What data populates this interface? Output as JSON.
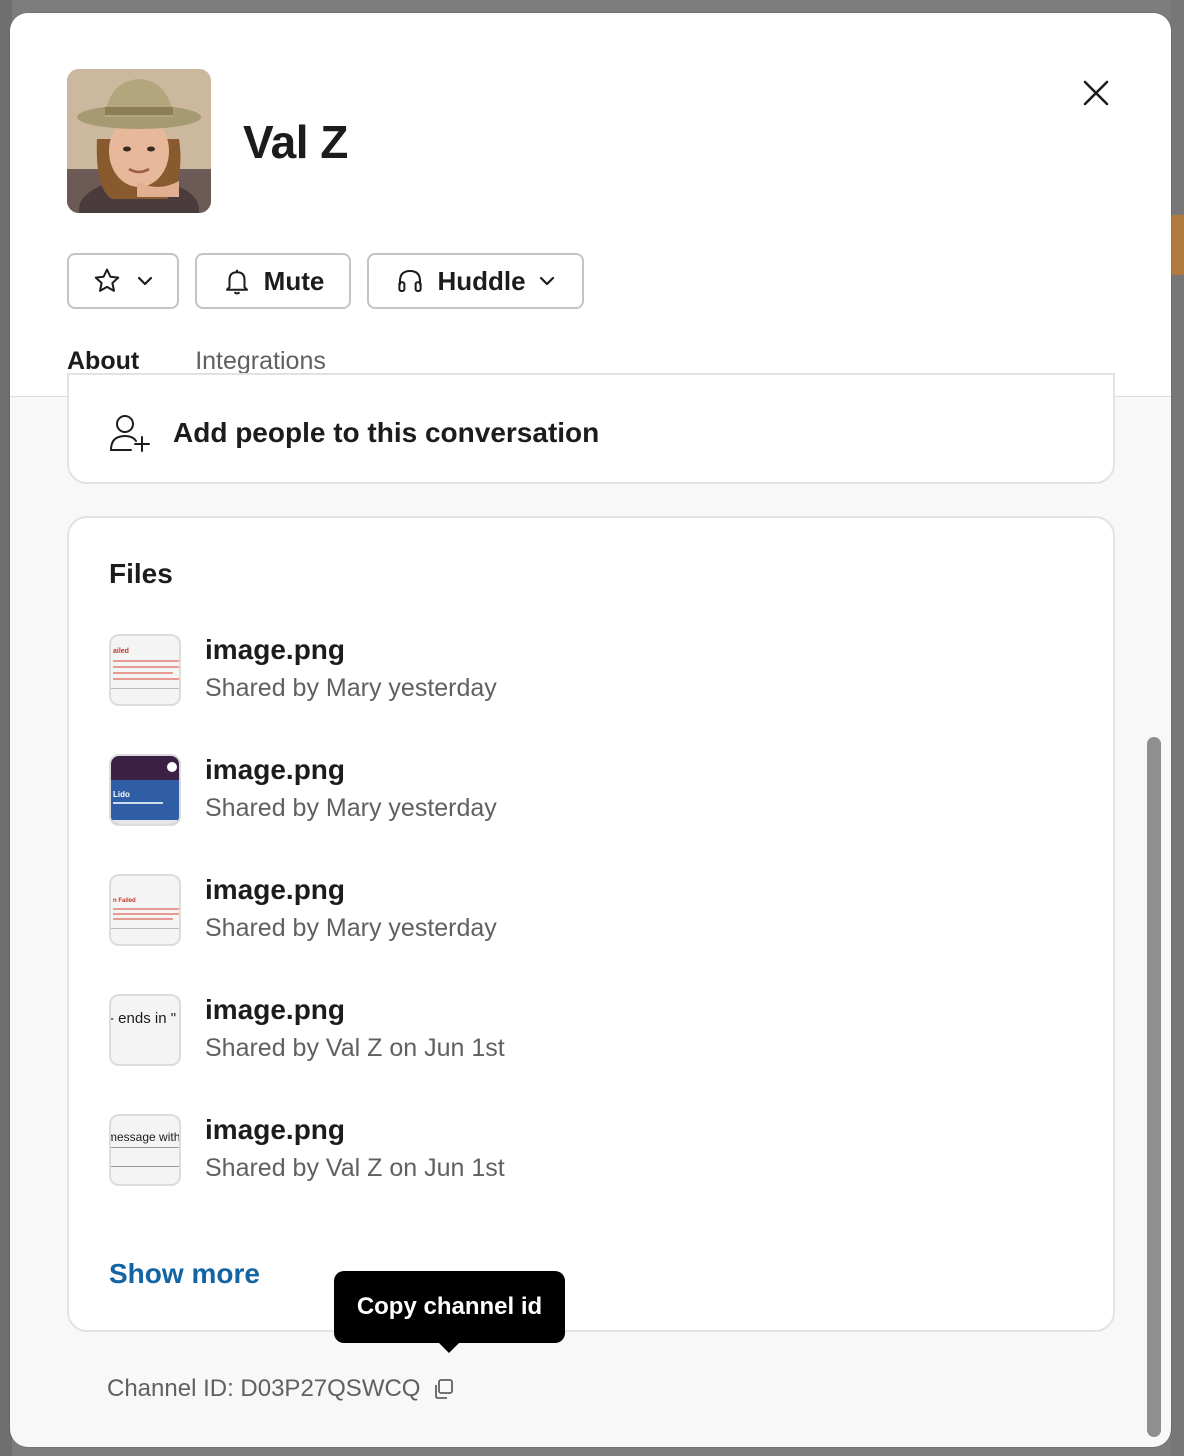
{
  "profile": {
    "name": "Val Z"
  },
  "actions": {
    "star_icon": "star-icon",
    "mute_label": "Mute",
    "huddle_label": "Huddle"
  },
  "tabs": [
    {
      "label": "About",
      "active": true
    },
    {
      "label": "Integrations",
      "active": false
    }
  ],
  "add_people": {
    "label": "Add people to this conversation"
  },
  "files": {
    "title": "Files",
    "items": [
      {
        "name": "image.png",
        "meta": "Shared by Mary yesterday",
        "thumb_text": "ailed"
      },
      {
        "name": "image.png",
        "meta": "Shared by Mary yesterday",
        "thumb_text": "Lido"
      },
      {
        "name": "image.png",
        "meta": "Shared by Mary yesterday",
        "thumb_text": "n Failed"
      },
      {
        "name": "image.png",
        "meta": "Shared by Val Z on Jun 1st",
        "thumb_text": "- ends in \""
      },
      {
        "name": "image.png",
        "meta": "Shared by Val Z on Jun 1st",
        "thumb_text": "message with"
      }
    ],
    "show_more": "Show more"
  },
  "footer": {
    "channel_id_text": "Channel ID: D03P27QSWCQ"
  },
  "tooltip": {
    "text": "Copy channel id"
  },
  "colors": {
    "accent_tab": "#2b7a5b",
    "link": "#1264a3",
    "tooltip_bg": "#000000"
  }
}
